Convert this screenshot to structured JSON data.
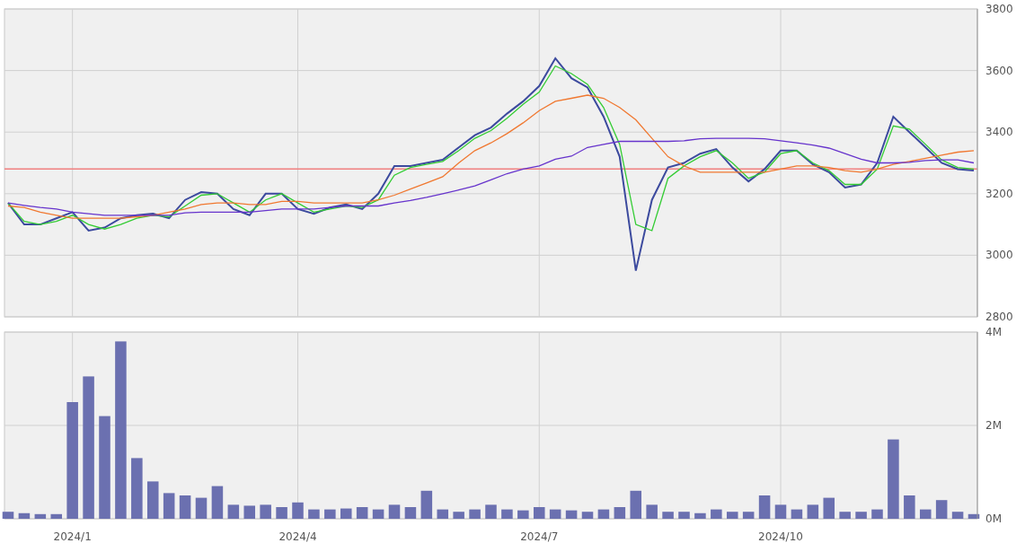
{
  "price_chart": {
    "chart_data": {
      "type": "line",
      "categories": [
        null,
        null,
        null,
        null,
        null,
        null,
        null,
        null,
        null,
        null,
        null,
        null,
        null,
        null,
        null,
        null,
        null,
        null,
        null,
        null,
        null,
        null,
        null,
        null,
        null,
        null,
        null,
        null,
        null,
        null,
        null,
        null,
        null,
        null,
        null,
        null,
        null,
        null,
        null,
        null,
        null,
        null,
        null,
        null,
        null,
        null,
        null,
        null,
        null,
        null,
        null,
        null,
        null,
        null,
        null,
        null,
        null,
        null,
        null,
        null,
        null
      ],
      "series": [
        {
          "color": "#3c4a9e",
          "values": [
            3170,
            3100,
            3100,
            3120,
            3140,
            3080,
            3090,
            3120,
            3130,
            3135,
            3120,
            3180,
            3205,
            3200,
            3150,
            3130,
            3200,
            3200,
            3150,
            3135,
            3155,
            3165,
            3150,
            3200,
            3290,
            3290,
            3300,
            3310,
            3350,
            3390,
            3415,
            3460,
            3500,
            3550,
            3640,
            3575,
            3545,
            3450,
            3320,
            2950,
            3180,
            3285,
            3300,
            3330,
            3345,
            3285,
            3240,
            3280,
            3340,
            3340,
            3295,
            3270,
            3220,
            3230,
            3300,
            3450,
            3400,
            3350,
            3300,
            3280,
            3275
          ]
        },
        {
          "color": "#33cc33",
          "values": [
            3170,
            3110,
            3100,
            3110,
            3130,
            3100,
            3085,
            3100,
            3120,
            3130,
            3125,
            3160,
            3195,
            3200,
            3170,
            3140,
            3180,
            3200,
            3170,
            3140,
            3150,
            3160,
            3155,
            3180,
            3260,
            3285,
            3295,
            3305,
            3340,
            3380,
            3405,
            3445,
            3490,
            3530,
            3615,
            3590,
            3555,
            3480,
            3360,
            3100,
            3080,
            3250,
            3290,
            3320,
            3340,
            3300,
            3250,
            3270,
            3330,
            3340,
            3300,
            3275,
            3230,
            3230,
            3280,
            3420,
            3410,
            3360,
            3310,
            3285,
            3280
          ]
        },
        {
          "color": "#f07830",
          "values": [
            3160,
            3155,
            3140,
            3130,
            3120,
            3120,
            3120,
            3120,
            3125,
            3130,
            3140,
            3150,
            3165,
            3170,
            3170,
            3165,
            3165,
            3175,
            3175,
            3170,
            3170,
            3170,
            3170,
            3180,
            3195,
            3215,
            3235,
            3255,
            3300,
            3340,
            3365,
            3395,
            3430,
            3470,
            3500,
            3510,
            3520,
            3510,
            3480,
            3440,
            3380,
            3320,
            3290,
            3270,
            3270,
            3270,
            3270,
            3270,
            3280,
            3290,
            3290,
            3285,
            3275,
            3270,
            3280,
            3295,
            3305,
            3315,
            3325,
            3335,
            3340
          ]
        },
        {
          "color": "#6633cc",
          "values": [
            3170,
            3162,
            3155,
            3150,
            3140,
            3135,
            3130,
            3130,
            3130,
            3130,
            3130,
            3138,
            3140,
            3140,
            3140,
            3140,
            3145,
            3150,
            3150,
            3150,
            3155,
            3160,
            3160,
            3160,
            3170,
            3178,
            3188,
            3200,
            3212,
            3225,
            3245,
            3265,
            3280,
            3290,
            3312,
            3322,
            3350,
            3360,
            3370,
            3370,
            3370,
            3370,
            3372,
            3378,
            3380,
            3380,
            3380,
            3378,
            3372,
            3365,
            3358,
            3348,
            3330,
            3312,
            3300,
            3300,
            3302,
            3308,
            3310,
            3310,
            3300
          ]
        }
      ],
      "ylim": [
        2800,
        3800
      ],
      "grid": true,
      "yticks": [
        {
          "value": 2800,
          "label": "2800"
        },
        {
          "value": 3000,
          "label": "3000"
        },
        {
          "value": 3200,
          "label": "3200"
        },
        {
          "value": 3400,
          "label": "3400"
        },
        {
          "value": 3600,
          "label": "3600"
        },
        {
          "value": 3800,
          "label": "3800"
        }
      ],
      "ref_lines": [
        {
          "axis": "y",
          "value": 3280
        }
      ]
    }
  },
  "volume_chart": {
    "chart_data": {
      "type": "bar",
      "categories": [
        null,
        null,
        null,
        null,
        "2024/1",
        null,
        null,
        null,
        null,
        null,
        null,
        null,
        null,
        null,
        null,
        null,
        null,
        null,
        "2024/4",
        null,
        null,
        null,
        null,
        null,
        null,
        null,
        null,
        null,
        null,
        null,
        null,
        null,
        null,
        "2024/7",
        null,
        null,
        null,
        null,
        null,
        null,
        null,
        null,
        null,
        null,
        null,
        null,
        null,
        null,
        "2024/10",
        null,
        null,
        null,
        null,
        null,
        null,
        null,
        null,
        null,
        null,
        null,
        null
      ],
      "series": [
        {
          "color": "#6b70b0",
          "values": [
            0.15,
            0.12,
            0.1,
            0.1,
            2.5,
            3.05,
            2.2,
            3.8,
            1.3,
            0.8,
            0.55,
            0.5,
            0.45,
            0.7,
            0.3,
            0.28,
            0.3,
            0.25,
            0.35,
            0.2,
            0.2,
            0.22,
            0.25,
            0.2,
            0.3,
            0.25,
            0.6,
            0.2,
            0.15,
            0.2,
            0.3,
            0.2,
            0.18,
            0.25,
            0.2,
            0.18,
            0.15,
            0.2,
            0.25,
            0.6,
            0.3,
            0.15,
            0.15,
            0.12,
            0.2,
            0.15,
            0.15,
            0.5,
            0.3,
            0.2,
            0.3,
            0.45,
            0.15,
            0.15,
            0.2,
            1.7,
            0.5,
            0.2,
            0.4,
            0.15,
            0.1
          ]
        }
      ],
      "ylim": [
        0,
        4
      ],
      "grid": true,
      "yticks": [
        {
          "value": 0,
          "label": "0M"
        },
        {
          "value": 2,
          "label": "2M"
        },
        {
          "value": 4,
          "label": "4M"
        }
      ]
    }
  }
}
